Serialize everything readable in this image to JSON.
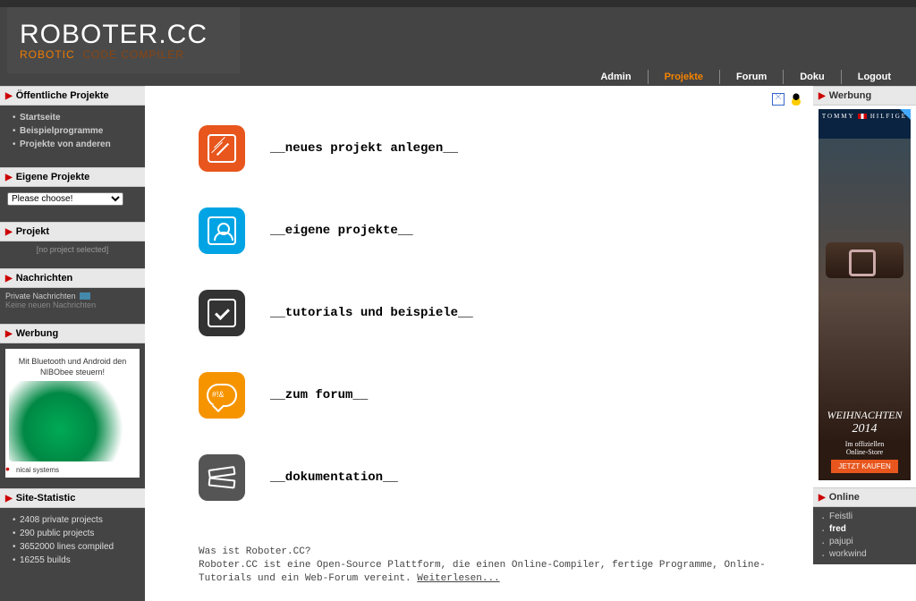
{
  "brand": {
    "title": "ROBOTER.CC",
    "sub_a": "ROBOTIC",
    "sub_b": "CODE COMPILER"
  },
  "nav": {
    "admin": "Admin",
    "projekte": "Projekte",
    "forum": "Forum",
    "doku": "Doku",
    "logout": "Logout"
  },
  "sidebar": {
    "public": {
      "title": "Öffentliche Projekte",
      "items": [
        "Startseite",
        "Beispielprogramme",
        "Projekte von anderen"
      ]
    },
    "own": {
      "title": "Eigene Projekte",
      "select_placeholder": "Please choose!"
    },
    "project": {
      "title": "Projekt",
      "none": "[no project selected]"
    },
    "messages": {
      "title": "Nachrichten",
      "label": "Private Nachrichten",
      "none": "Keine neuen Nachrichten"
    },
    "ads": {
      "title": "Werbung",
      "text": "Mit Bluetooth und Android den NIBObee steuern!",
      "brand": "nicai systems"
    },
    "stats": {
      "title": "Site-Statistic",
      "items": [
        "2408 private projects",
        "290 public projects",
        "3652000 lines compiled",
        "16255 builds"
      ]
    }
  },
  "hub": {
    "new": "__neues projekt anlegen__",
    "own": "__eigene projekte__",
    "tut": "__tutorials und beispiele__",
    "forum": "__zum forum__",
    "doc": "__dokumentation__"
  },
  "about": {
    "q": "Was ist Roboter.CC?",
    "body": "Roboter.CC ist eine Open-Source Plattform, die einen Online-Compiler, fertige Programme, Online-Tutorials und ein Web-Forum vereint. ",
    "more": "Weiterlesen..."
  },
  "right": {
    "ads_title": "Werbung",
    "tommy": {
      "brand_a": "TOMMY",
      "brand_b": "HILFIGE",
      "h1": "WEIHNACHTEN",
      "h2": "2014",
      "p1": "Im offiziellen",
      "p2": "Online-Store",
      "btn": "JETZT KAUFEN"
    },
    "online_title": "Online",
    "online": [
      "Feistli",
      "fred",
      "pajupi",
      "workwind"
    ],
    "online_me": "fred"
  }
}
